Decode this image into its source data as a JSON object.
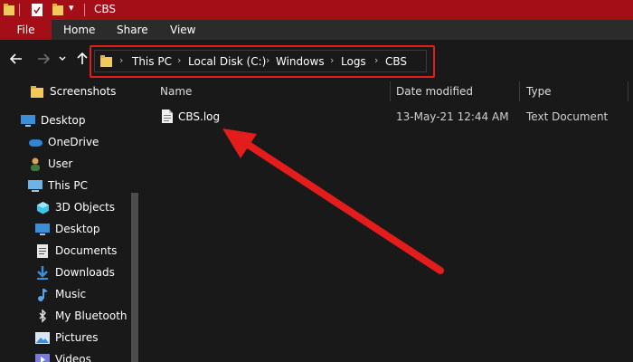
{
  "window": {
    "title": "CBS"
  },
  "ribbon": {
    "tabs": [
      "File",
      "Home",
      "Share",
      "View"
    ]
  },
  "address": {
    "crumbs": [
      "This PC",
      "Local Disk (C:)",
      "Windows",
      "Logs",
      "CBS"
    ]
  },
  "sidebar": {
    "items": [
      {
        "label": "Screenshots",
        "icon": "folder-icon"
      },
      {
        "label": "Desktop",
        "icon": "desktop-icon"
      },
      {
        "label": "OneDrive",
        "icon": "cloud-icon"
      },
      {
        "label": "User",
        "icon": "user-icon"
      },
      {
        "label": "This PC",
        "icon": "pc-icon"
      },
      {
        "label": "3D Objects",
        "icon": "cube-icon"
      },
      {
        "label": "Desktop",
        "icon": "desktop-icon"
      },
      {
        "label": "Documents",
        "icon": "documents-icon"
      },
      {
        "label": "Downloads",
        "icon": "download-icon"
      },
      {
        "label": "Music",
        "icon": "music-icon"
      },
      {
        "label": "My Bluetooth D",
        "icon": "bluetooth-icon"
      },
      {
        "label": "Pictures",
        "icon": "pictures-icon"
      },
      {
        "label": "Videos",
        "icon": "videos-icon"
      }
    ]
  },
  "list": {
    "columns": [
      "Name",
      "Date modified",
      "Type"
    ],
    "rows": [
      {
        "name": "CBS.log",
        "date": "13-May-21 12:44 AM",
        "type": "Text Document"
      }
    ]
  },
  "colors": {
    "accent_red": "#a40e16",
    "highlight": "#e31c1c",
    "background": "#191919"
  }
}
